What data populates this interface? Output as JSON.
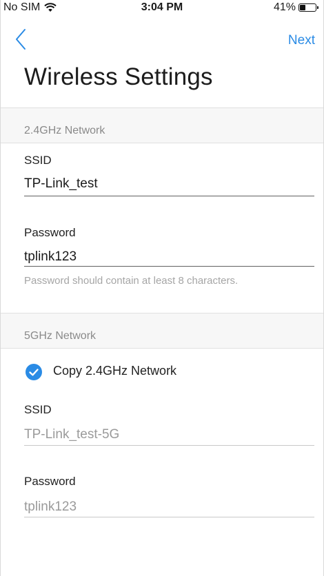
{
  "status_bar": {
    "carrier": "No SIM",
    "time": "3:04 PM",
    "battery": "41%",
    "battery_level": 0.41
  },
  "nav": {
    "next_label": "Next"
  },
  "page": {
    "title": "Wireless Settings"
  },
  "network_24": {
    "header": "2.4GHz Network",
    "ssid_label": "SSID",
    "ssid_value": "TP-Link_test",
    "password_label": "Password",
    "password_value": "tplink123",
    "password_hint": "Password should contain at least 8 characters."
  },
  "network_5": {
    "header": "5GHz Network",
    "copy_label": "Copy 2.4GHz Network",
    "copy_checked": true,
    "ssid_label": "SSID",
    "ssid_value": "TP-Link_test-5G",
    "password_label": "Password",
    "password_value": "tplink123"
  },
  "colors": {
    "accent": "#2a8be5",
    "header_bg": "#f7f7f7",
    "muted_text": "#9a9a9a"
  }
}
